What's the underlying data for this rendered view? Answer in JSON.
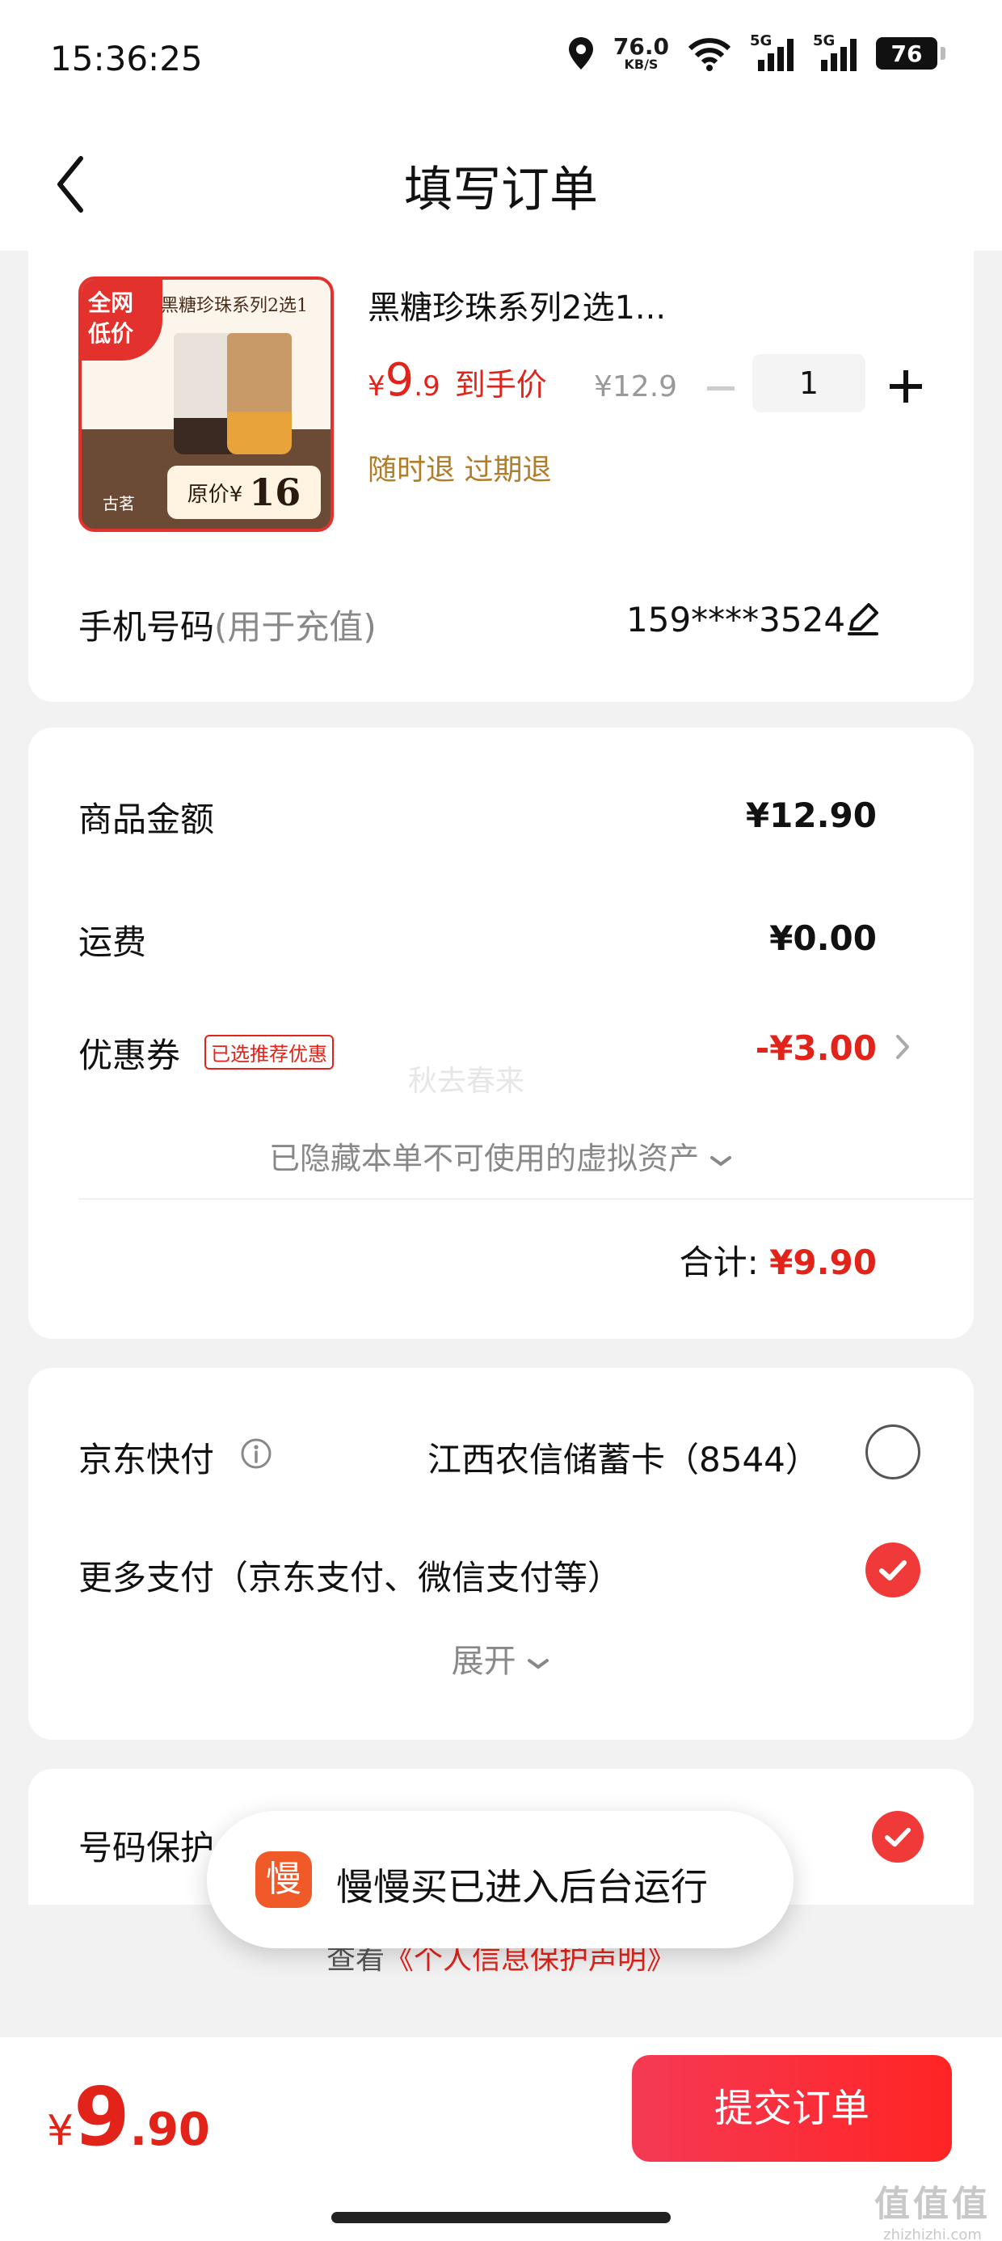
{
  "status_bar": {
    "time": "15:36:25",
    "net_speed": "76.0",
    "net_unit": "KB/S",
    "signal1_tag": "5G",
    "signal2_tag": "5G",
    "battery": "76",
    "icons": [
      "location-icon",
      "wifi-icon",
      "signal-icon",
      "battery-icon"
    ]
  },
  "header": {
    "title": "填写订单",
    "back_icon": "chevron-left-icon"
  },
  "product": {
    "thumbnail": {
      "corner_badge_line1": "全网",
      "corner_badge_line2": "低价",
      "series_text": "黑糖珍珠系列2选1",
      "brand_text": "古茗",
      "original_price_label": "原价¥",
      "original_price_value": "16"
    },
    "name": "黑糖珍珠系列2选1...",
    "price_currency": "¥",
    "price_int": "9",
    "price_dec": ".9",
    "price_tag": "到手价",
    "original_price": "¥12.9",
    "quantity": "1",
    "policy": "随时退 过期退"
  },
  "phone": {
    "label": "手机号码",
    "hint": "(用于充值)",
    "value": "159****3524",
    "icon": "pencil-icon"
  },
  "amounts": {
    "goods_label": "商品金额",
    "goods_value": "¥12.90",
    "shipping_label": "运费",
    "shipping_value": "¥0.00",
    "coupon_label": "优惠券",
    "coupon_badge": "已选推荐优惠",
    "coupon_value": "-¥3.00",
    "watermark": "秋去春来",
    "hidden_assets": "已隐藏本单不可使用的虚拟资产",
    "total_label": "合计:",
    "total_value": "¥9.90"
  },
  "payment": {
    "quickpay_label": "京东快付",
    "quickpay_card": "江西农信储蓄卡（8544）",
    "quickpay_selected": false,
    "more_label": "更多支付（京东支付、微信支付等）",
    "more_selected": true,
    "expand_label": "展开"
  },
  "protection": {
    "label": "号码保护",
    "selected": true
  },
  "privacy": {
    "prefix": "查看",
    "link": "《个人信息保护声明》"
  },
  "toast": {
    "icon_char": "慢",
    "text": "慢慢买已进入后台运行"
  },
  "bottom": {
    "price_currency": "¥",
    "price_int": "9",
    "price_dec": ".90",
    "submit_label": "提交订单"
  },
  "site_mark": {
    "big": "值值值",
    "small": "zhizhizhi.com"
  },
  "colors": {
    "accent": "#e2231a",
    "button": "#ff2424",
    "policy": "#b07d2a"
  }
}
